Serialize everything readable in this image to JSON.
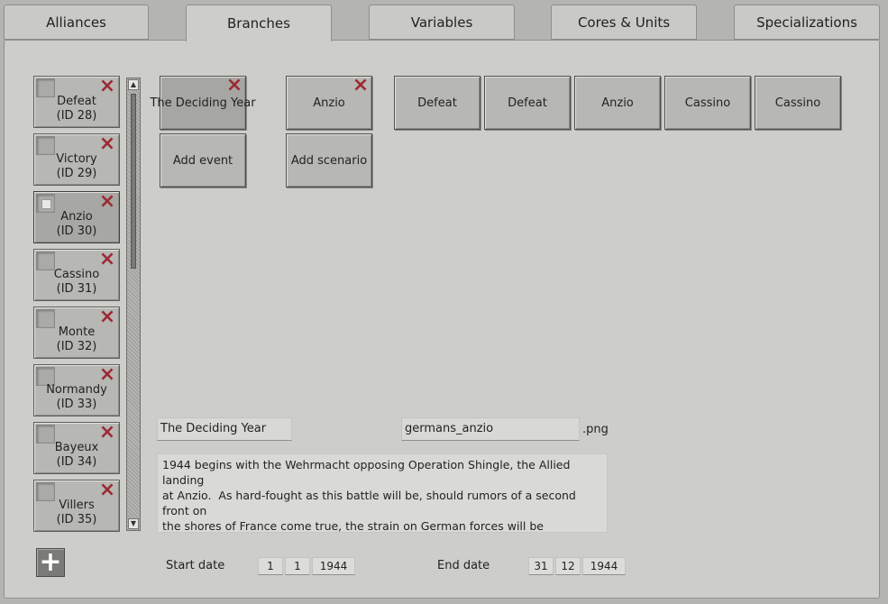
{
  "tabs": [
    {
      "label": "Alliances",
      "active": false
    },
    {
      "label": "Branches",
      "active": true
    },
    {
      "label": "Variables",
      "active": false
    },
    {
      "label": "Cores & Units",
      "active": false
    },
    {
      "label": "Specializations",
      "active": false
    }
  ],
  "list_items": [
    {
      "name": "Defeat",
      "id": "(ID 28)",
      "checked": false,
      "selected": false
    },
    {
      "name": "Victory",
      "id": "(ID 29)",
      "checked": false,
      "selected": false
    },
    {
      "name": "Anzio",
      "id": "(ID 30)",
      "checked": true,
      "selected": true
    },
    {
      "name": "Cassino",
      "id": "(ID 31)",
      "checked": false,
      "selected": false
    },
    {
      "name": "Monte",
      "id": "(ID 32)",
      "checked": false,
      "selected": false
    },
    {
      "name": "Normandy",
      "id": "(ID 33)",
      "checked": false,
      "selected": false
    },
    {
      "name": "Bayeux",
      "id": "(ID 34)",
      "checked": false,
      "selected": false
    },
    {
      "name": "Villers",
      "id": "(ID 35)",
      "checked": false,
      "selected": false
    }
  ],
  "events": {
    "selected": "The Deciding Year",
    "add_label": "Add event"
  },
  "scenarios": {
    "item": "Anzio",
    "add_label": "Add scenario"
  },
  "outcomes": [
    "Defeat",
    "Defeat",
    "Anzio",
    "Cassino",
    "Cassino"
  ],
  "icons": {
    "delete": "×",
    "add": "+",
    "scroll_up": "▲",
    "scroll_down": "▼"
  },
  "form": {
    "title_value": "The Deciding Year",
    "image_value": "germans_anzio",
    "image_ext": ".png",
    "description": "1944 begins with the Wehrmacht opposing Operation Shingle, the Allied landing\nat Anzio.  As hard-fought as this battle will be, should rumors of a second front on\nthe shores of France come true, the strain on German forces will be enormous.\nAdd the Red Menace coming from the east and it is quite evident the fate of the\nThird Reich is at stake.",
    "start_label": "Start date",
    "start_day": "1",
    "start_month": "1",
    "start_year": "1944",
    "end_label": "End date",
    "end_day": "31",
    "end_month": "12",
    "end_year": "1944"
  },
  "colors": {
    "delete_icon": "#9c2a33",
    "panel": "#cdcdca",
    "button": "#b7b7b4"
  }
}
